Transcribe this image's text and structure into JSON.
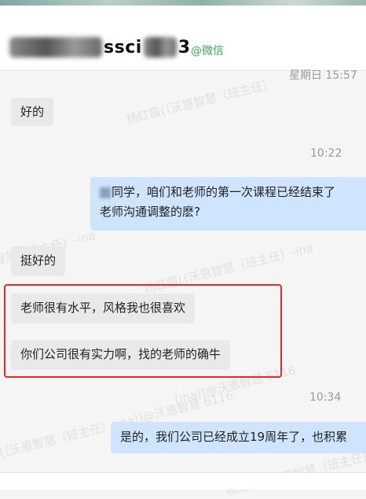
{
  "chat": {
    "contact_prefix": "",
    "contact_visible": "ssci",
    "contact_suffix": "3",
    "source_tag": "@微信"
  },
  "timestamps": {
    "top": "星期日 15:57",
    "t1": "10:22",
    "t2": "10:34"
  },
  "messages": [
    {
      "side": "in",
      "text": "好的"
    },
    {
      "side": "out",
      "line1": "同学，咱们和老师的第一次课程已经结束了",
      "line2": "老师沟通调整的麽?"
    },
    {
      "side": "in",
      "text": "挺好的"
    },
    {
      "side": "in",
      "text": "老师很有水平，风格我也很喜欢"
    },
    {
      "side": "in",
      "text": "你们公司很有实力啊，找的老师的确牛"
    },
    {
      "side": "out",
      "text": "是的，我们公司已经成立19周年了，也积累"
    }
  ],
  "watermarks": [
    "杨红霞(（沃恩智慧（班主任）",
    "智慧（班主任）-ina",
    "杨红霞(（沃恩智慧（班主任）-ina",
    "116",
    "(ina))@沃恩智慧 6116",
    "霞(（沃恩智慧（班主任）-ina))@沃恩智慧 6116",
    "杨红霞(（沃恩智慧（班主任）"
  ]
}
